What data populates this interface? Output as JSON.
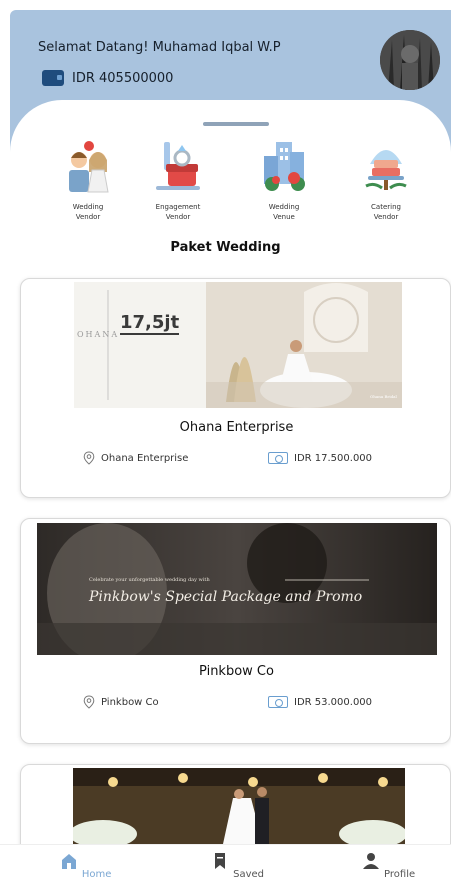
{
  "header": {
    "greeting": "Selamat Datang! Muhamad Iqbal W.P",
    "balance": "IDR 405500000"
  },
  "categories": [
    {
      "label": "Wedding\nVendor"
    },
    {
      "label": "Engagement\nVendor"
    },
    {
      "label": "Wedding\nVenue"
    },
    {
      "label": "Catering\nVendor"
    }
  ],
  "section": {
    "title": "Paket Wedding"
  },
  "packages": [
    {
      "title": "Ohana Enterprise",
      "vendor": "Ohana Enterprise",
      "price": "IDR 17.500.000",
      "banner": {
        "brand": "OHANA",
        "price_tag": "17,5jt",
        "caption": "Ohana Bridal"
      }
    },
    {
      "title": "Pinkbow Co",
      "vendor": "Pinkbow Co",
      "price": "IDR 53.000.000",
      "banner": {
        "kicker": "Celebrate your unforgettable wedding day with",
        "headline": "Pinkbow's Special Package and Promo"
      }
    }
  ],
  "nav": {
    "home": "Home",
    "saved": "Saved",
    "profile": "Profile"
  },
  "colors": {
    "header_bg": "#a9c3de",
    "accent": "#7ba7d3"
  }
}
